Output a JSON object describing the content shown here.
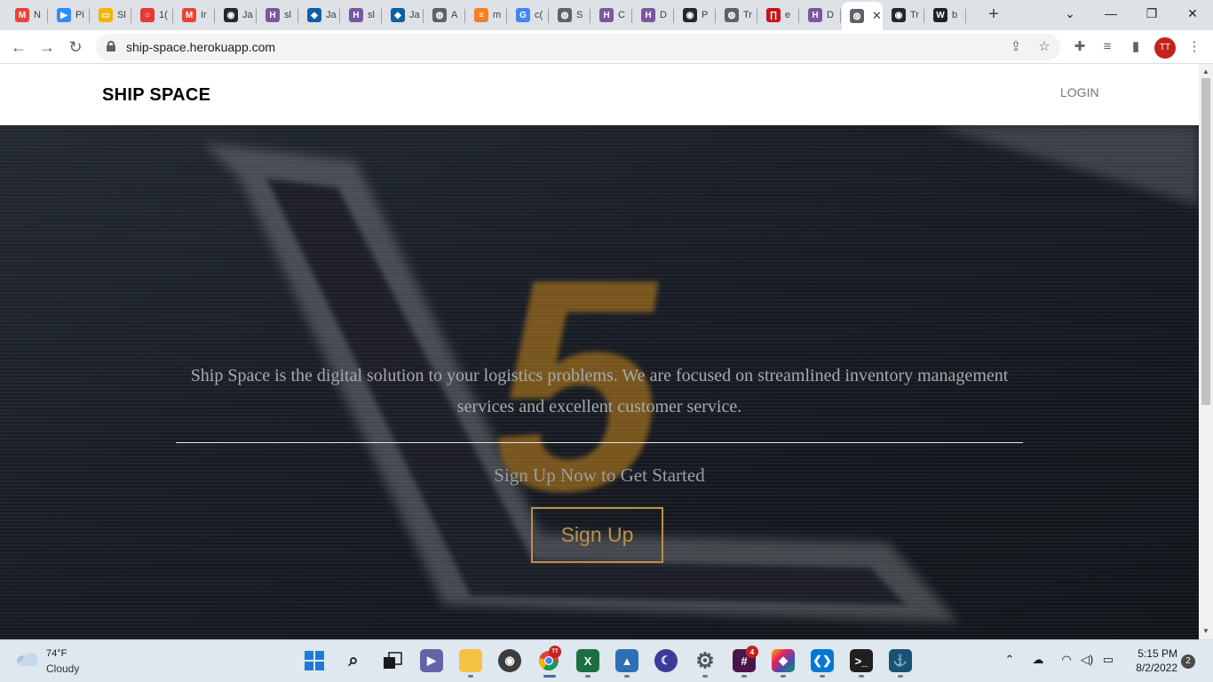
{
  "tabs": [
    {
      "label": "N",
      "icon": "gmail-icon",
      "color": "#ea4335",
      "glyph": "M"
    },
    {
      "label": "Pi",
      "icon": "zoom-icon",
      "color": "#2d8cff",
      "glyph": "▶"
    },
    {
      "label": "Sl",
      "icon": "slides-icon",
      "color": "#f4b400",
      "glyph": "▭"
    },
    {
      "label": "1(",
      "icon": "loading-icon",
      "color": "#e53935",
      "glyph": "○"
    },
    {
      "label": "Ir",
      "icon": "gmail-icon",
      "color": "#ea4335",
      "glyph": "M"
    },
    {
      "label": "Ja",
      "icon": "github-icon",
      "color": "#24292f",
      "glyph": "◉"
    },
    {
      "label": "sl",
      "icon": "heroku-icon",
      "color": "#79589f",
      "glyph": "H"
    },
    {
      "label": "Ja",
      "icon": "jamstack-icon",
      "color": "#0d5fa6",
      "glyph": "◆"
    },
    {
      "label": "sl",
      "icon": "heroku-icon",
      "color": "#79589f",
      "glyph": "H"
    },
    {
      "label": "Ja",
      "icon": "jamstack-icon",
      "color": "#0d5fa6",
      "glyph": "◆"
    },
    {
      "label": "A",
      "icon": "globe-icon",
      "color": "#5f6368",
      "glyph": "◍"
    },
    {
      "label": "m",
      "icon": "stackoverflow-icon",
      "color": "#f48024",
      "glyph": "≡"
    },
    {
      "label": "c(",
      "icon": "google-icon",
      "color": "#4285f4",
      "glyph": "G"
    },
    {
      "label": "S",
      "icon": "globe-icon",
      "color": "#5f6368",
      "glyph": "◍"
    },
    {
      "label": "C",
      "icon": "heroku-icon",
      "color": "#79589f",
      "glyph": "H"
    },
    {
      "label": "D",
      "icon": "heroku-icon",
      "color": "#79589f",
      "glyph": "H"
    },
    {
      "label": "P",
      "icon": "github-icon",
      "color": "#24292f",
      "glyph": "◉"
    },
    {
      "label": "Tr",
      "icon": "globe-icon",
      "color": "#5f6368",
      "glyph": "◍"
    },
    {
      "label": "e",
      "icon": "netlify-icon",
      "color": "#c4161c",
      "glyph": "∏"
    },
    {
      "label": "D",
      "icon": "heroku-icon",
      "color": "#79589f",
      "glyph": "H"
    },
    {
      "label": "",
      "icon": "globe-icon",
      "color": "#5f6368",
      "glyph": "◍",
      "active": true
    },
    {
      "label": "Tr",
      "icon": "github-icon",
      "color": "#24292f",
      "glyph": "◉"
    },
    {
      "label": "b",
      "icon": "wikipedia-icon",
      "color": "#202124",
      "glyph": "W"
    }
  ],
  "browser": {
    "url": "ship-space.herokuapp.com",
    "profile_initials": "TT"
  },
  "page": {
    "brand": "SHIP SPACE",
    "login_label": "LOGIN",
    "description": "Ship Space is the digital solution to your logistics problems. We are focused on streamlined inventory management services and excellent customer service.",
    "cta_text": "Sign Up Now to Get Started",
    "signup_label": "Sign Up",
    "hero_number": "5",
    "accent_color": "#c28f48"
  },
  "taskbar": {
    "weather_temp": "74°F",
    "weather_desc": "Cloudy",
    "time": "5:15 PM",
    "date": "8/2/2022",
    "notification_count": "2",
    "chrome_badge": "TT",
    "slack_badge": "4"
  }
}
